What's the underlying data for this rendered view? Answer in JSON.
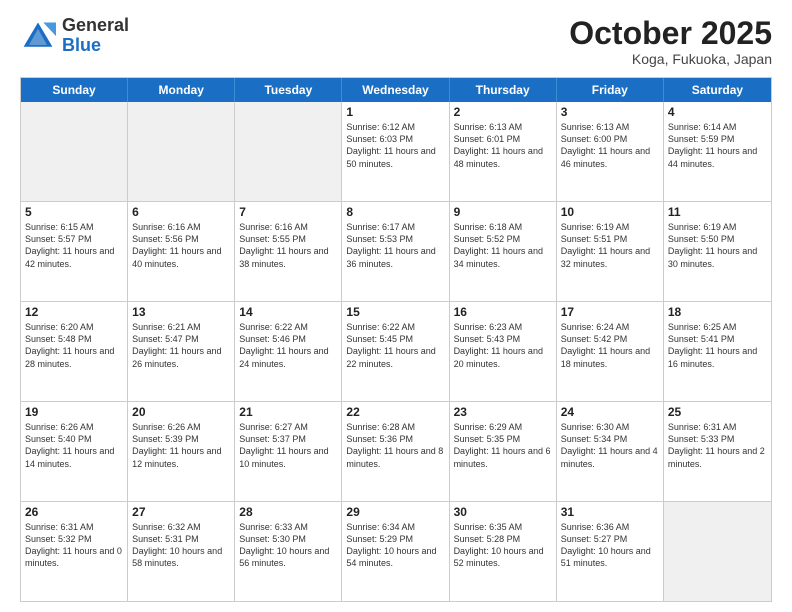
{
  "header": {
    "logo": {
      "general": "General",
      "blue": "Blue"
    },
    "title": "October 2025",
    "location": "Koga, Fukuoka, Japan"
  },
  "weekdays": [
    "Sunday",
    "Monday",
    "Tuesday",
    "Wednesday",
    "Thursday",
    "Friday",
    "Saturday"
  ],
  "rows": [
    [
      {
        "day": "",
        "info": "",
        "shaded": true
      },
      {
        "day": "",
        "info": "",
        "shaded": true
      },
      {
        "day": "",
        "info": "",
        "shaded": true
      },
      {
        "day": "1",
        "info": "Sunrise: 6:12 AM\nSunset: 6:03 PM\nDaylight: 11 hours\nand 50 minutes."
      },
      {
        "day": "2",
        "info": "Sunrise: 6:13 AM\nSunset: 6:01 PM\nDaylight: 11 hours\nand 48 minutes."
      },
      {
        "day": "3",
        "info": "Sunrise: 6:13 AM\nSunset: 6:00 PM\nDaylight: 11 hours\nand 46 minutes."
      },
      {
        "day": "4",
        "info": "Sunrise: 6:14 AM\nSunset: 5:59 PM\nDaylight: 11 hours\nand 44 minutes."
      }
    ],
    [
      {
        "day": "5",
        "info": "Sunrise: 6:15 AM\nSunset: 5:57 PM\nDaylight: 11 hours\nand 42 minutes."
      },
      {
        "day": "6",
        "info": "Sunrise: 6:16 AM\nSunset: 5:56 PM\nDaylight: 11 hours\nand 40 minutes."
      },
      {
        "day": "7",
        "info": "Sunrise: 6:16 AM\nSunset: 5:55 PM\nDaylight: 11 hours\nand 38 minutes."
      },
      {
        "day": "8",
        "info": "Sunrise: 6:17 AM\nSunset: 5:53 PM\nDaylight: 11 hours\nand 36 minutes."
      },
      {
        "day": "9",
        "info": "Sunrise: 6:18 AM\nSunset: 5:52 PM\nDaylight: 11 hours\nand 34 minutes."
      },
      {
        "day": "10",
        "info": "Sunrise: 6:19 AM\nSunset: 5:51 PM\nDaylight: 11 hours\nand 32 minutes."
      },
      {
        "day": "11",
        "info": "Sunrise: 6:19 AM\nSunset: 5:50 PM\nDaylight: 11 hours\nand 30 minutes."
      }
    ],
    [
      {
        "day": "12",
        "info": "Sunrise: 6:20 AM\nSunset: 5:48 PM\nDaylight: 11 hours\nand 28 minutes."
      },
      {
        "day": "13",
        "info": "Sunrise: 6:21 AM\nSunset: 5:47 PM\nDaylight: 11 hours\nand 26 minutes."
      },
      {
        "day": "14",
        "info": "Sunrise: 6:22 AM\nSunset: 5:46 PM\nDaylight: 11 hours\nand 24 minutes."
      },
      {
        "day": "15",
        "info": "Sunrise: 6:22 AM\nSunset: 5:45 PM\nDaylight: 11 hours\nand 22 minutes."
      },
      {
        "day": "16",
        "info": "Sunrise: 6:23 AM\nSunset: 5:43 PM\nDaylight: 11 hours\nand 20 minutes."
      },
      {
        "day": "17",
        "info": "Sunrise: 6:24 AM\nSunset: 5:42 PM\nDaylight: 11 hours\nand 18 minutes."
      },
      {
        "day": "18",
        "info": "Sunrise: 6:25 AM\nSunset: 5:41 PM\nDaylight: 11 hours\nand 16 minutes."
      }
    ],
    [
      {
        "day": "19",
        "info": "Sunrise: 6:26 AM\nSunset: 5:40 PM\nDaylight: 11 hours\nand 14 minutes."
      },
      {
        "day": "20",
        "info": "Sunrise: 6:26 AM\nSunset: 5:39 PM\nDaylight: 11 hours\nand 12 minutes."
      },
      {
        "day": "21",
        "info": "Sunrise: 6:27 AM\nSunset: 5:37 PM\nDaylight: 11 hours\nand 10 minutes."
      },
      {
        "day": "22",
        "info": "Sunrise: 6:28 AM\nSunset: 5:36 PM\nDaylight: 11 hours\nand 8 minutes."
      },
      {
        "day": "23",
        "info": "Sunrise: 6:29 AM\nSunset: 5:35 PM\nDaylight: 11 hours\nand 6 minutes."
      },
      {
        "day": "24",
        "info": "Sunrise: 6:30 AM\nSunset: 5:34 PM\nDaylight: 11 hours\nand 4 minutes."
      },
      {
        "day": "25",
        "info": "Sunrise: 6:31 AM\nSunset: 5:33 PM\nDaylight: 11 hours\nand 2 minutes."
      }
    ],
    [
      {
        "day": "26",
        "info": "Sunrise: 6:31 AM\nSunset: 5:32 PM\nDaylight: 11 hours\nand 0 minutes."
      },
      {
        "day": "27",
        "info": "Sunrise: 6:32 AM\nSunset: 5:31 PM\nDaylight: 10 hours\nand 58 minutes."
      },
      {
        "day": "28",
        "info": "Sunrise: 6:33 AM\nSunset: 5:30 PM\nDaylight: 10 hours\nand 56 minutes."
      },
      {
        "day": "29",
        "info": "Sunrise: 6:34 AM\nSunset: 5:29 PM\nDaylight: 10 hours\nand 54 minutes."
      },
      {
        "day": "30",
        "info": "Sunrise: 6:35 AM\nSunset: 5:28 PM\nDaylight: 10 hours\nand 52 minutes."
      },
      {
        "day": "31",
        "info": "Sunrise: 6:36 AM\nSunset: 5:27 PM\nDaylight: 10 hours\nand 51 minutes."
      },
      {
        "day": "",
        "info": "",
        "shaded": true
      }
    ]
  ]
}
